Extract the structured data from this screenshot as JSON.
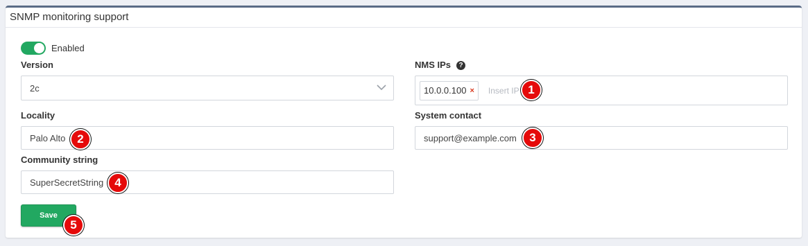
{
  "panel": {
    "title": "SNMP monitoring support"
  },
  "toggle": {
    "label": "Enabled",
    "state": "on"
  },
  "version": {
    "label": "Version",
    "value": "2c"
  },
  "nms": {
    "label": "NMS IPs",
    "help_icon": "?",
    "tags": [
      "10.0.0.100"
    ],
    "remove_glyph": "×",
    "placeholder": "Insert IP"
  },
  "locality": {
    "label": "Locality",
    "value": "Palo Alto"
  },
  "system_contact": {
    "label": "System contact",
    "value": "support@example.com"
  },
  "community": {
    "label": "Community string",
    "value": "SuperSecretString"
  },
  "save": {
    "label": "Save"
  },
  "markers": [
    "1",
    "2",
    "3",
    "4",
    "5"
  ],
  "colors": {
    "accent_green": "#22a861",
    "panel_border": "#5a6b86",
    "marker_red": "#e50a0a",
    "tag_remove": "#d9381e"
  }
}
